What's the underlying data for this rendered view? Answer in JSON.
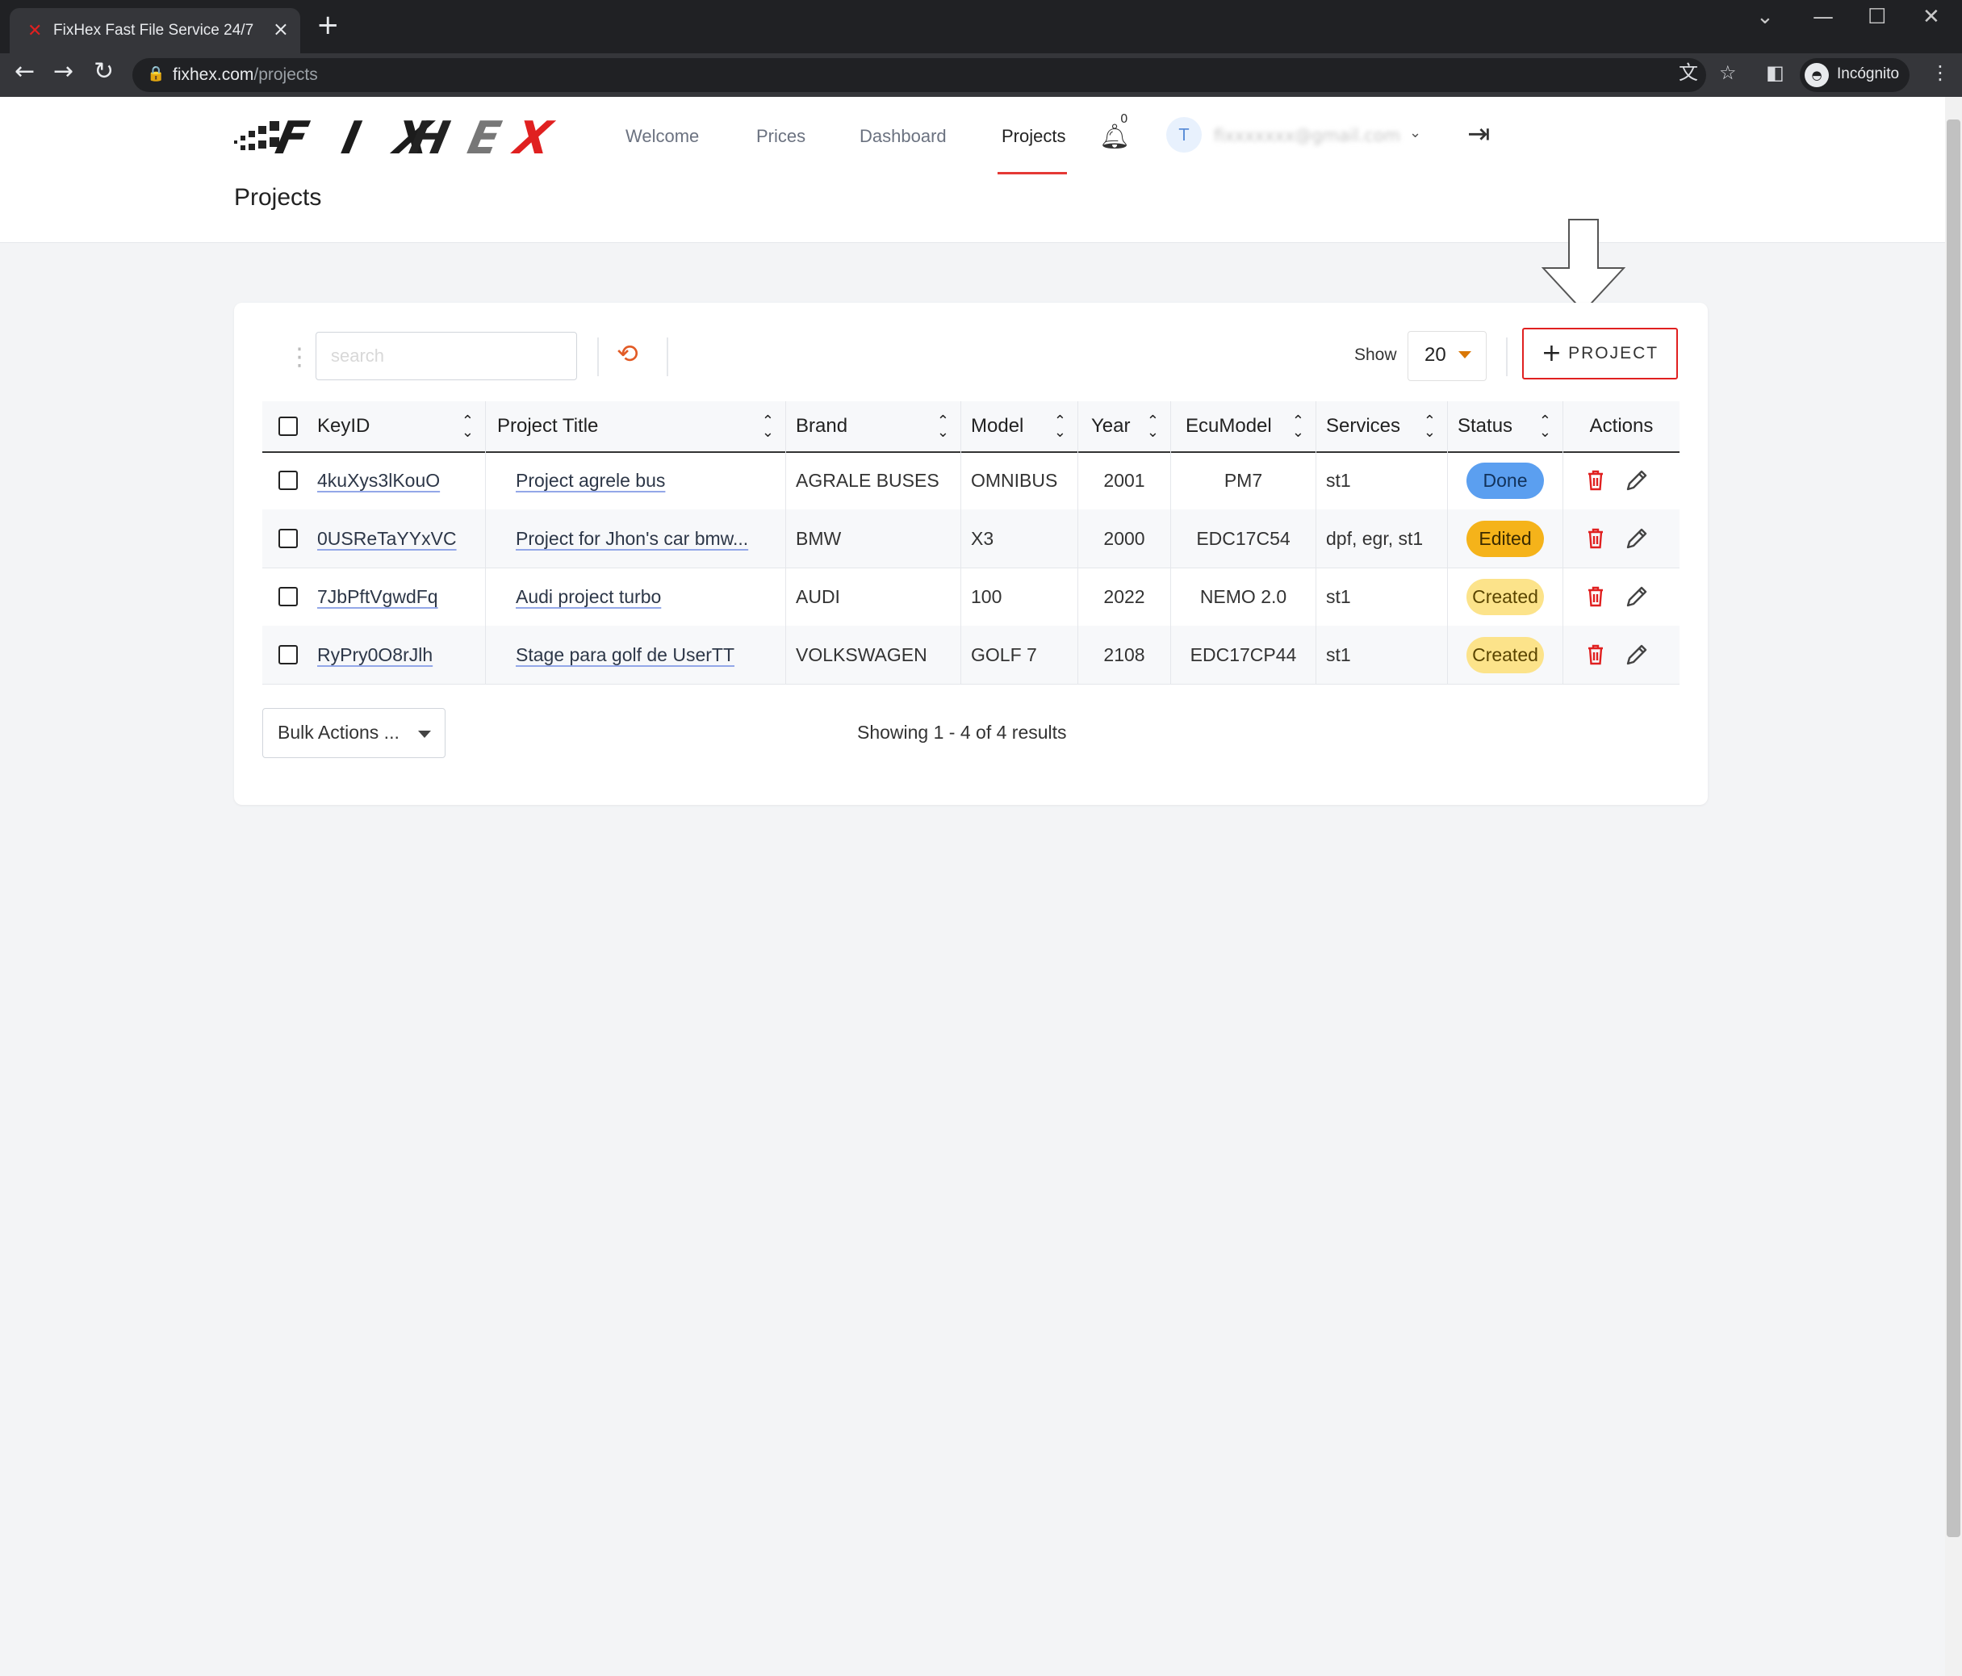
{
  "browser": {
    "tab_title": "FixHex Fast File Service 24/7",
    "url_host": "fixhex.com",
    "url_path": "/projects",
    "incognito_label": "Incógnito"
  },
  "nav": {
    "items": [
      "Welcome",
      "Prices",
      "Dashboard",
      "Projects"
    ],
    "notification_count": "0",
    "avatar_initial": "T",
    "user_email": "fixxxxxxx@gmail.com"
  },
  "page": {
    "title": "Projects"
  },
  "toolbar": {
    "search_placeholder": "search",
    "show_label": "Show",
    "page_size": "20",
    "add_label": "PROJECT"
  },
  "table": {
    "headers": [
      "KeyID",
      "Project Title",
      "Brand",
      "Model",
      "Year",
      "EcuModel",
      "Services",
      "Status",
      "Actions"
    ],
    "rows": [
      {
        "key": "4kuXys3lKouO",
        "title": "Project agrele bus",
        "brand": "AGRALE BUSES",
        "model": "OMNIBUS",
        "year": "2001",
        "ecu": "PM7",
        "services": "st1",
        "status": "Done"
      },
      {
        "key": "0USReTaYYxVC",
        "title": "Project for Jhon's car bmw...",
        "brand": "BMW",
        "model": "X3",
        "year": "2000",
        "ecu": "EDC17C54",
        "services": "dpf, egr, st1",
        "status": "Edited"
      },
      {
        "key": "7JbPftVgwdFq",
        "title": "Audi project turbo",
        "brand": "AUDI",
        "model": "100",
        "year": "2022",
        "ecu": "NEMO 2.0",
        "services": "st1",
        "status": "Created"
      },
      {
        "key": "RyPry0O8rJlh",
        "title": "Stage para golf de UserTT",
        "brand": "VOLKSWAGEN",
        "model": "GOLF 7",
        "year": "2108",
        "ecu": "EDC17CP44",
        "services": "st1",
        "status": "Created"
      }
    ]
  },
  "footer": {
    "bulk_label": "Bulk Actions ...",
    "summary": "Showing 1 - 4 of 4 results"
  },
  "colors": {
    "accent_red": "#e02020",
    "done": "#5b9ff0",
    "edited": "#f5b31a",
    "created": "#fce38a",
    "reset_icon": "#e25b26"
  }
}
